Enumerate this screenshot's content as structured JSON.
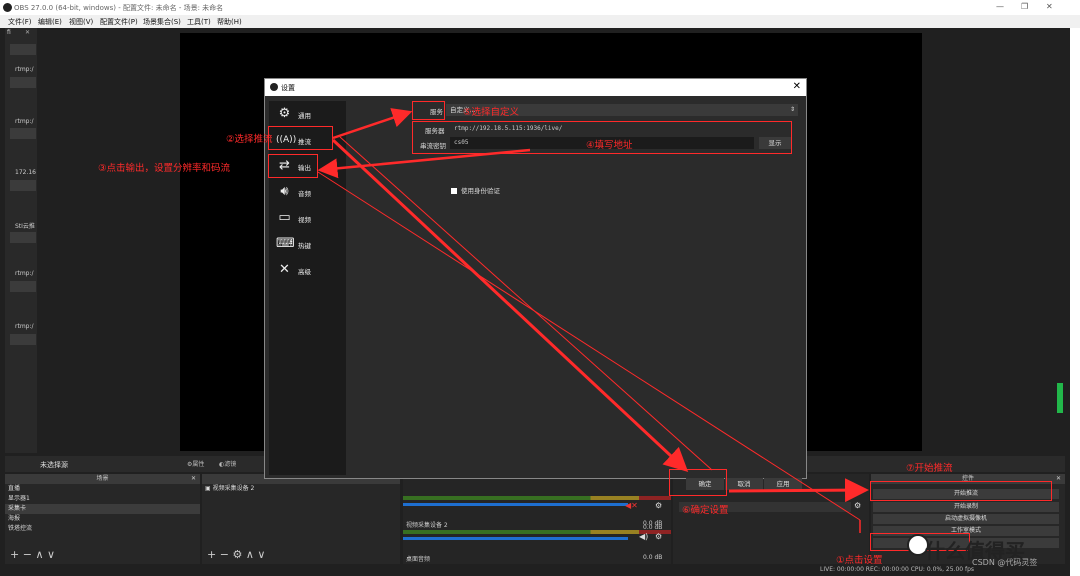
{
  "window": {
    "title": "OBS 27.0.0 (64-bit, windows) - 配置文件: 未命名 - 场景: 未命名",
    "min_icon": "minimize-icon",
    "max_icon": "maximize-icon",
    "close_icon": "close-icon"
  },
  "menu": [
    "文件(F)",
    "编辑(E)",
    "视图(V)",
    "配置文件(P)",
    "场景集合(S)",
    "工具(T)",
    "帮助(H)"
  ],
  "left_dock": {
    "tab": "fi",
    "labels": [
      "rtmp:/",
      "rtmp:/",
      "172.16",
      "StI云推",
      "rtmp:/",
      "rtmp:/"
    ]
  },
  "source_bar": {
    "selected": "未选择源",
    "properties": "属性",
    "filters": "滤镜"
  },
  "scenes": {
    "header": "场景",
    "items": [
      "直播",
      "显示器1",
      "采集卡",
      "海报",
      "铁塔控流"
    ],
    "selected_index": 2
  },
  "sources": {
    "item": "视频采集设备 2"
  },
  "mixer": {
    "rows": [
      {
        "name": "",
        "db": "0.0 dB"
      },
      {
        "name": "视频采集设备 2",
        "db": "0.0 dB"
      },
      {
        "name": "桌面音频",
        "db": "0.0 dB"
      }
    ]
  },
  "controls": {
    "header": "控件",
    "buttons": [
      "开始推流",
      "开始录制",
      "启动虚拟摄像机",
      "工作室模式"
    ]
  },
  "status": {
    "text": "LIVE: 00:00:00    REC: 00:00:00    CPU: 0.0%, 25.00 fps"
  },
  "dialog": {
    "title": "设置",
    "nav": [
      {
        "label": "通用",
        "icon": "gear-icon"
      },
      {
        "label": "推流",
        "icon": "antenna-icon"
      },
      {
        "label": "输出",
        "icon": "output-icon"
      },
      {
        "label": "音频",
        "icon": "speaker-icon"
      },
      {
        "label": "视频",
        "icon": "monitor-icon"
      },
      {
        "label": "热键",
        "icon": "keyboard-icon"
      },
      {
        "label": "高级",
        "icon": "wrench-icon"
      }
    ],
    "service_label": "服务",
    "service_value": "自定义...",
    "server_label": "服务器",
    "server_value": "rtmp://192.18.5.115:1936/live/",
    "key_label": "串流密钥",
    "key_value": "cs05",
    "show_button": "显示",
    "auth_label": "使用身份验证",
    "ok_button": "确定",
    "cancel_button": "取消",
    "apply_button": "应用"
  },
  "annotations": {
    "a1": "①点击设置",
    "a2": "②选择推流",
    "a3": "③点击输出，设置分辨率和码流",
    "a4": "④填写地址",
    "a5": "⑤选择自定义",
    "a6": "⑥确定设置",
    "a7": "⑦开始推流"
  },
  "watermark": {
    "text": "什么值得买",
    "sub": "CSDN @代码灵签"
  }
}
